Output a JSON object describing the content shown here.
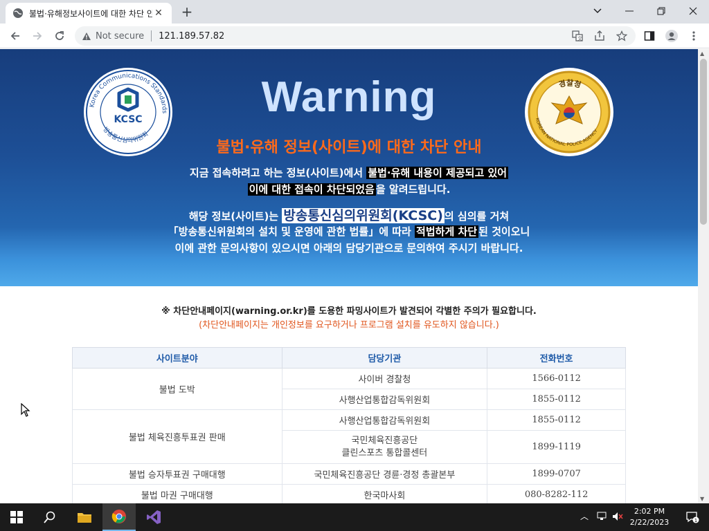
{
  "browser": {
    "tab_title": "불법·유해정보사이트에 대한 차단 안내",
    "new_tab": "+",
    "address": {
      "security_label": "Not secure",
      "url": "121.189.57.82"
    }
  },
  "banner": {
    "kcsc_logo": {
      "ring_text": "Korea Communications Standards Commission",
      "inner_text": "KCSC",
      "bottom_text": "방송통신심의위원회"
    },
    "police_logo": {
      "top_text": "경찰청",
      "ring_text": "KOREAN NATIONAL POLICE AGENCY"
    },
    "title": "Warning",
    "subtitle": "불법·유해 정보(사이트)에 대한 차단 안내",
    "line1_plain": "지금 접속하려고 하는 정보(사이트)에서 ",
    "line1_hl": "불법·유해 내용이 제공되고 있어",
    "line2_hl": "이에 대한 접속이 차단되었음",
    "line2_plain": "을 알려드립니다.",
    "line3_a": "해당 정보(사이트)는 ",
    "line3_big": "방송통신심의위원회(KCSC)",
    "line3_b": "의 심의를 거쳐",
    "line4_a": "「방송통신위원회의 설치 및 운영에 관한 법률」에 따라 ",
    "line4_hl": "적법하게 차단",
    "line4_b": "된 것이오니",
    "line5": "이에 관한 문의사항이 있으시면 아래의 담당기관으로 문의하여 주시기 바랍니다."
  },
  "notice": {
    "line1": "※ 차단안내페이지(warning.or.kr)를 도용한 파밍사이트가 발견되어 각별한 주의가 필요합니다.",
    "line2": "(차단안내페이지는 개인정보를 요구하거나 프로그램 설치를 유도하지 않습니다.)"
  },
  "table": {
    "headers": [
      "사이트분야",
      "담당기관",
      "전화번호"
    ],
    "rows": [
      {
        "field": "불법 도박",
        "org": "사이버 경찰청",
        "phone": "1566-0112"
      },
      {
        "org": "사행산업통합감독위원회",
        "phone": "1855-0112"
      },
      {
        "field": "불법 체육진흥투표권 판매",
        "org": "사행산업통합감독위원회",
        "phone": "1855-0112"
      },
      {
        "org": "국민체육진흥공단",
        "org2": "클린스포츠 통합콜센터",
        "phone": "1899-1119"
      },
      {
        "field": "불법 승자투표권 구매대행",
        "org": "국민체육진흥공단 경륜·경정 총괄본부",
        "phone": "1899-0707"
      },
      {
        "field": "불법 마권 구매대행",
        "org": "한국마사회",
        "phone": "080-8282-112"
      }
    ]
  },
  "taskbar": {
    "time": "2:02 PM",
    "date": "2/22/2023",
    "notification_count": "1"
  },
  "colors": {
    "banner_top": "#173d7c",
    "banner_bottom": "#4ba6ea",
    "warning_title": "#cfe3ff",
    "subtitle": "#ff6a1a",
    "notice_warn": "#e0561e",
    "table_header_text": "#1e5aa8"
  }
}
